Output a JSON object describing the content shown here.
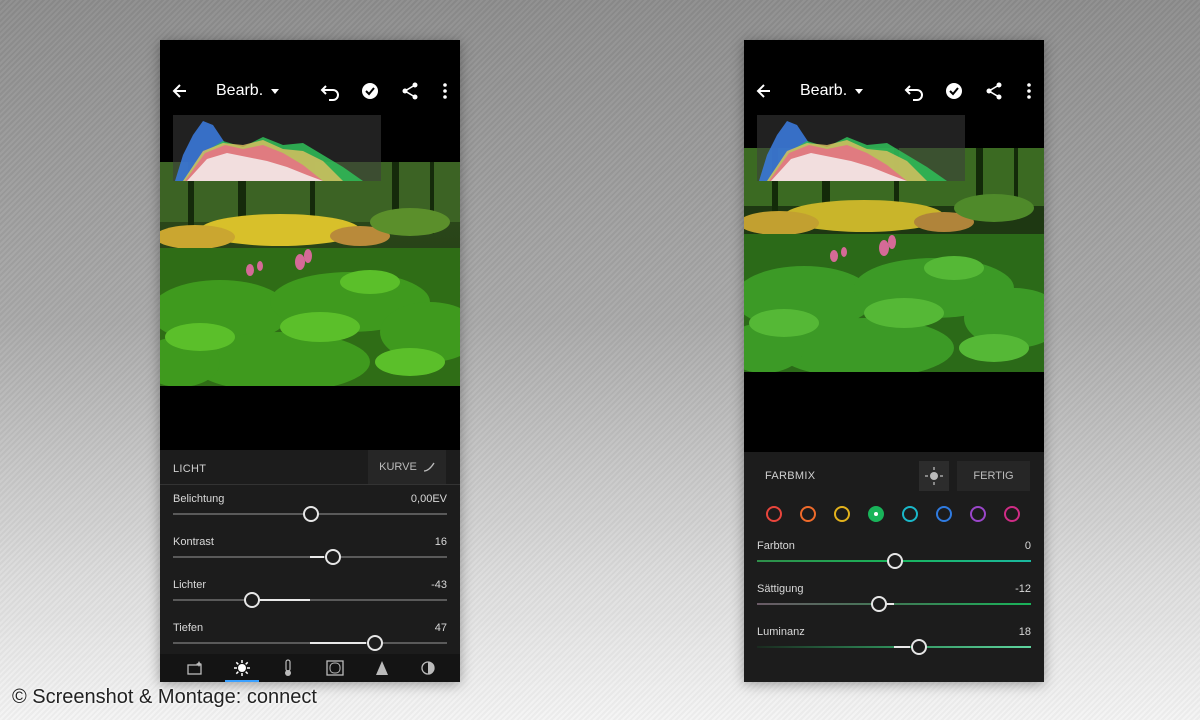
{
  "left": {
    "header": {
      "title": "Bearb."
    },
    "section_label": "LICHT",
    "kurve_label": "KURVE",
    "sliders": [
      {
        "name": "Belichtung",
        "value": "0,00EV",
        "position": 0.5
      },
      {
        "name": "Kontrast",
        "value": "16",
        "position": 0.58
      },
      {
        "name": "Lichter",
        "value": "-43",
        "position": 0.285
      },
      {
        "name": "Tiefen",
        "value": "47",
        "position": 0.735
      }
    ],
    "toolbar_tools": [
      "auto-icon",
      "sun-icon",
      "thermometer-icon",
      "vignette-icon",
      "triangle-icon",
      "lens-icon"
    ],
    "active_tool": "sun-icon"
  },
  "right": {
    "header": {
      "title": "Bearb."
    },
    "section_label": "FARBMIX",
    "fertig_label": "FERTIG",
    "colors": [
      {
        "name": "red",
        "hex": "#e8453c"
      },
      {
        "name": "orange",
        "hex": "#ee6a2a"
      },
      {
        "name": "yellow",
        "hex": "#e3b21c"
      },
      {
        "name": "green",
        "hex": "#19b45a",
        "selected": true
      },
      {
        "name": "aqua",
        "hex": "#1ab8c9"
      },
      {
        "name": "blue",
        "hex": "#2f7be0"
      },
      {
        "name": "purple",
        "hex": "#9a46c9"
      },
      {
        "name": "magenta",
        "hex": "#cf2c85"
      }
    ],
    "sliders": [
      {
        "name": "Farbton",
        "value": "0",
        "position": 0.5
      },
      {
        "name": "Sättigung",
        "value": "-12",
        "position": 0.44
      },
      {
        "name": "Luminanz",
        "value": "18",
        "position": 0.59
      }
    ]
  },
  "credit": "© Screenshot & Montage: connect"
}
